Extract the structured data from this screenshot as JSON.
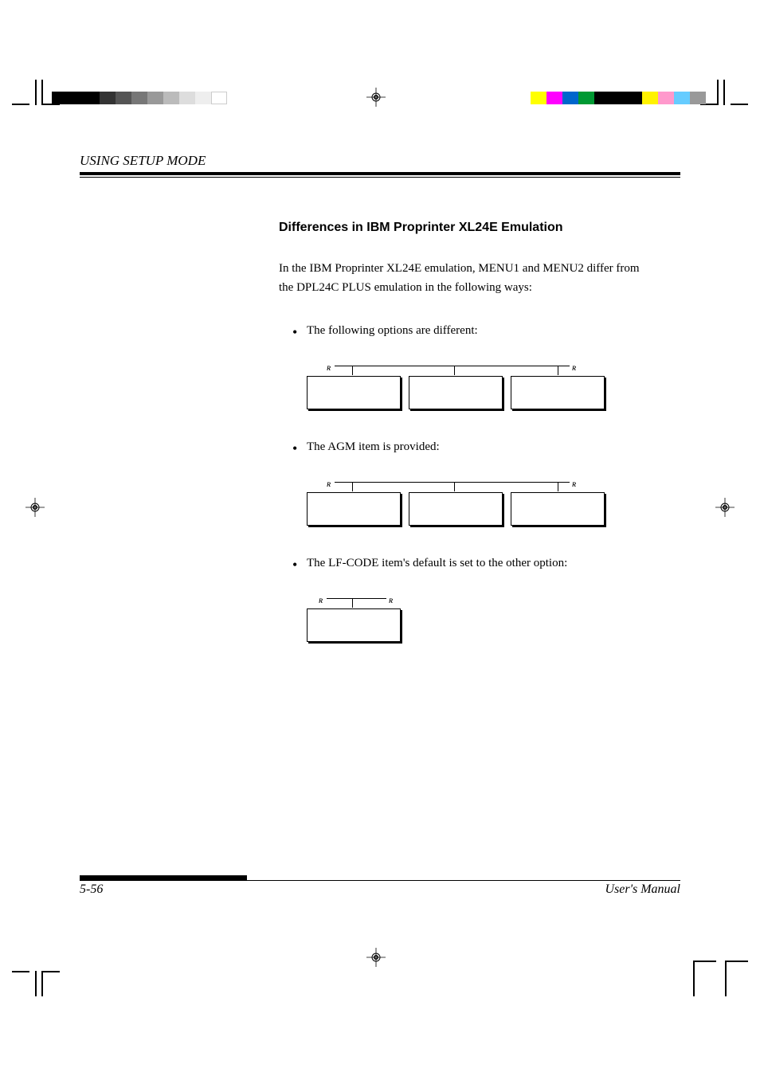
{
  "header": {
    "text": "USING SETUP MODE"
  },
  "content": {
    "section_title": "Differences in IBM Proprinter XL24E Emulation",
    "intro": "In the IBM Proprinter XL24E emulation, MENU1 and MENU2 differ from the DPL24C PLUS emulation in the following ways:",
    "bullets": [
      "The following options are different:",
      "The AGM item is provided:",
      "The LF-CODE item's default is set to the other option:"
    ]
  },
  "footer": {
    "page_number": "5-56",
    "doc_title": "User's Manual"
  }
}
